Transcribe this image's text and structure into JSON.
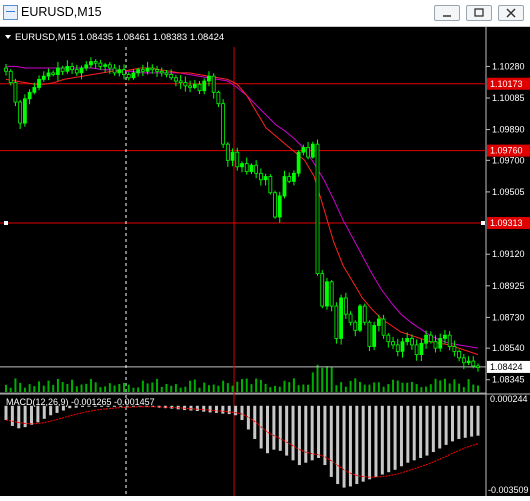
{
  "window": {
    "title": "EURUSD,M15",
    "buttons": [
      "minimize",
      "restore",
      "close"
    ]
  },
  "info_line": {
    "text": "EURUSD,M15  1.08435 1.08461 1.08383 1.08424"
  },
  "macd_label": "MACD(12,26,9) -0.001265 -0.001457",
  "price_axis": {
    "labels": [
      "1.10280",
      "1.10085",
      "1.09890",
      "1.09700",
      "1.09505",
      "1.09120",
      "1.08925",
      "1.08730",
      "1.08540",
      "1.08345"
    ],
    "highlighted": [
      {
        "value": "1.10173",
        "color": "#e00000"
      },
      {
        "value": "1.09760",
        "color": "#e00000"
      },
      {
        "value": "1.09313",
        "color": "#e00000"
      },
      {
        "value": "1.08424",
        "color": "#000000"
      }
    ]
  },
  "macd_axis": {
    "labels": [
      "0.000244",
      "-0.003509"
    ]
  },
  "colors": {
    "background": "#000000",
    "bull_candle": "#00ff00",
    "bear_candle": "#00c800",
    "ma_fast": "#ff2020",
    "ma_slow": "#d000d0",
    "hline": "#e00000",
    "histogram": "#c8c8c8",
    "signal": "#ff0000",
    "volume": "#00b000"
  },
  "chart_data": {
    "type": "candlestick",
    "symbol": "EURUSD",
    "timeframe": "M15",
    "ylim": [
      1.083,
      1.104
    ],
    "last_ohlc": {
      "open": 1.08435,
      "high": 1.08461,
      "low": 1.08383,
      "close": 1.08424
    },
    "horizontal_levels": [
      1.10173,
      1.0976,
      1.09313,
      1.08424
    ],
    "close_path": [
      1.1025,
      1.1018,
      1.1006,
      1.0993,
      1.1008,
      1.1012,
      1.1015,
      1.102,
      1.1022,
      1.1024,
      1.1023,
      1.1027,
      1.1025,
      1.1028,
      1.1026,
      1.1024,
      1.1027,
      1.1029,
      1.1031,
      1.103,
      1.1028,
      1.1029,
      1.1027,
      1.1024,
      1.1026,
      1.1023,
      1.1021,
      1.1024,
      1.1026,
      1.1025,
      1.1027,
      1.1026,
      1.1025,
      1.1024,
      1.1023,
      1.1021,
      1.1019,
      1.1018,
      1.1016,
      1.1015,
      1.1017,
      1.1013,
      1.1019,
      1.1022,
      1.1012,
      1.1005,
      1.098,
      1.097,
      1.0975,
      1.0966,
      1.0968,
      1.0963,
      1.0967,
      1.0962,
      1.0958,
      1.096,
      1.095,
      1.0935,
      1.0948,
      1.096,
      1.0957,
      1.0962,
      1.0975,
      1.0978,
      1.0972,
      1.098,
      1.09,
      1.088,
      1.0895,
      1.088,
      1.086,
      1.0885,
      1.0875,
      1.087,
      1.0865,
      1.088,
      1.087,
      1.0855,
      1.0868,
      1.0872,
      1.0862,
      1.0858,
      1.0856,
      1.0852,
      1.0858,
      1.086,
      1.0856,
      1.085,
      1.0857,
      1.0862,
      1.0858,
      1.0854,
      1.086,
      1.0862,
      1.0855,
      1.0852,
      1.0848,
      1.0845,
      1.0846,
      1.0843,
      1.0842
    ],
    "ma_fast_path": [
      1.102,
      1.1019,
      1.1018,
      1.1017,
      1.1017,
      1.1018,
      1.102,
      1.1021,
      1.1022,
      1.1023,
      1.1024,
      1.1025,
      1.1025,
      1.1026,
      1.1027,
      1.1027,
      1.1026,
      1.1025,
      1.1024,
      1.1024,
      1.1023,
      1.1022,
      1.1021,
      1.102,
      1.1017,
      1.101,
      1.1,
      1.099,
      1.0985,
      1.098,
      1.0975,
      1.097,
      1.096,
      1.094,
      1.092,
      1.0905,
      1.0895,
      1.0885,
      1.0878,
      1.0872,
      1.0868,
      1.0864,
      1.0862,
      1.086,
      1.0858,
      1.0857,
      1.0856,
      1.0854,
      1.0852,
      1.085
    ],
    "ma_slow_path": [
      1.1028,
      1.1028,
      1.1027,
      1.1027,
      1.1027,
      1.1027,
      1.1027,
      1.1027,
      1.1027,
      1.1027,
      1.1026,
      1.1026,
      1.1025,
      1.1025,
      1.1024,
      1.1024,
      1.1024,
      1.1024,
      1.1024,
      1.1023,
      1.1022,
      1.1021,
      1.102,
      1.1019,
      1.1015,
      1.101,
      1.1004,
      1.0998,
      1.0992,
      1.0988,
      1.0983,
      1.0977,
      1.0968,
      1.0958,
      1.0946,
      1.0933,
      1.0922,
      1.0911,
      1.09,
      1.089,
      1.0882,
      1.0875,
      1.087,
      1.0866,
      1.0862,
      1.0859,
      1.0857,
      1.0856,
      1.0855,
      1.0854
    ],
    "macd_histogram": [
      -0.0006,
      -0.00085,
      -0.00095,
      -0.0009,
      -0.0008,
      -0.0007,
      -0.00055,
      -0.0004,
      -0.0003,
      -0.0002,
      -0.0001,
      -8e-05,
      -5e-05,
      0,
      0,
      0,
      0,
      0,
      0,
      0,
      0,
      0,
      -3e-05,
      -5e-05,
      -8e-05,
      -0.0001,
      -0.00012,
      -0.00015,
      -0.00018,
      -0.0002,
      -0.00022,
      -0.00025,
      -0.00028,
      -0.0003,
      -0.00033,
      -0.00035,
      -0.0004,
      -0.0006,
      -0.001,
      -0.0014,
      -0.0018,
      -0.002,
      -0.00185,
      -0.0019,
      -0.0021,
      -0.0023,
      -0.0025,
      -0.0024,
      -0.0023,
      -0.0022,
      -0.0025,
      -0.003,
      -0.0033,
      -0.00345,
      -0.0034,
      -0.0033,
      -0.0032,
      -0.0031,
      -0.003,
      -0.0029,
      -0.0028,
      -0.0027,
      -0.00255,
      -0.0024,
      -0.0023,
      -0.0022,
      -0.0021,
      -0.00195,
      -0.0018,
      -0.00165,
      -0.0015,
      -0.0014,
      -0.00135,
      -0.0013,
      -0.00126
    ]
  }
}
